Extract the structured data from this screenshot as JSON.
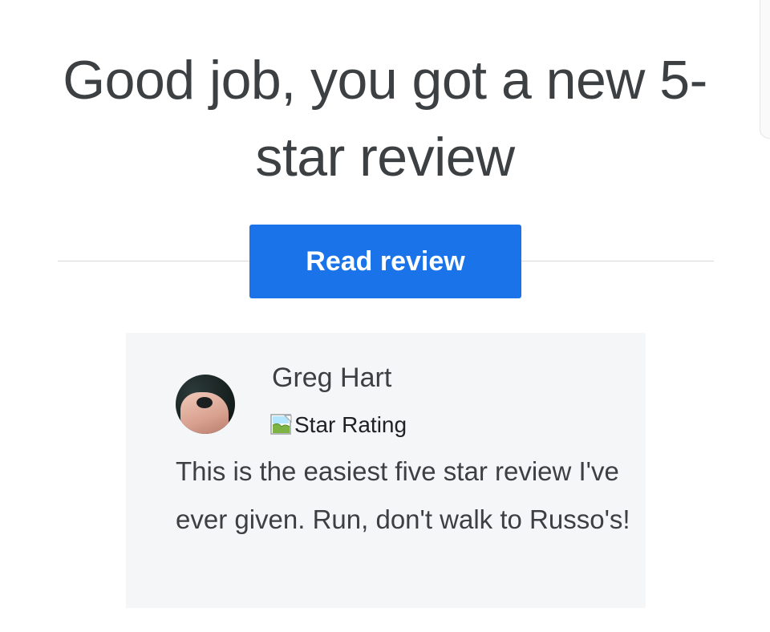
{
  "headline": "Good job, you got a new 5-star review",
  "cta": {
    "label": "Read review",
    "color": "#1a73e8"
  },
  "review": {
    "reviewer_name": "Greg Hart",
    "star_rating_alt": "Star Rating",
    "text": "This is the easiest five star review I've ever given. Run, don't walk to Russo's!",
    "avatar_icon": "user-avatar-photo",
    "broken_image_icon": "broken-image-icon"
  }
}
